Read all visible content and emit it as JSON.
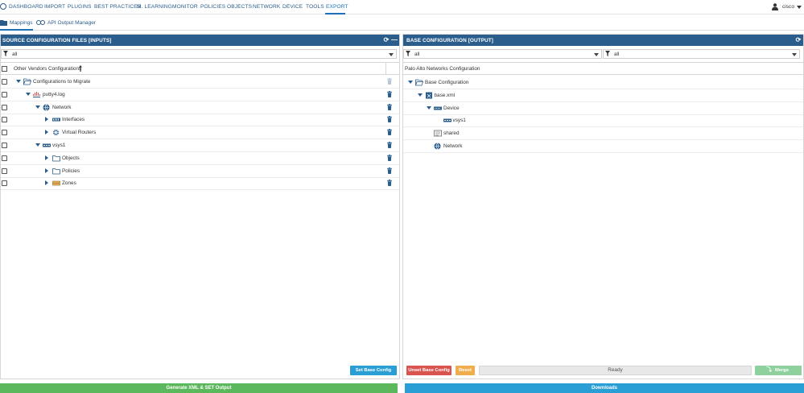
{
  "nav": {
    "items": [
      "DASHBOARD",
      "IMPORT",
      "PLUGINS",
      "BEST PRACTICES",
      "M. LEARNING",
      "MONITOR",
      "POLICIES",
      "OBJECTS",
      "NETWORK",
      "DEVICE",
      "TOOLS",
      "EXPORT"
    ],
    "active": "EXPORT",
    "user": "cisco"
  },
  "subnav": {
    "tabs": [
      "Mappings",
      "API Output Manager"
    ],
    "active": "Mappings"
  },
  "left_panel": {
    "title": "SOURCE CONFIGURATION FILES [INPUTS]",
    "filter": "all",
    "tree_header": "Other Vendors Configurations",
    "rows": [
      {
        "label": "Configurations to Migrate",
        "icon": "folder-open-icon",
        "level": 0,
        "state": "open"
      },
      {
        "label": "putty4.log",
        "icon": "cisco-logo-icon",
        "level": 1,
        "state": "open"
      },
      {
        "label": "Network",
        "icon": "globe-icon",
        "level": 2,
        "state": "open"
      },
      {
        "label": "Interfaces",
        "icon": "ethernet-port-icon",
        "level": 3,
        "state": "closed"
      },
      {
        "label": "Virtual Routers",
        "icon": "router-icon",
        "level": 3,
        "state": "closed"
      },
      {
        "label": "vsys1",
        "icon": "vsys-icon",
        "level": 2,
        "state": "open"
      },
      {
        "label": "Objects",
        "icon": "folder-icon",
        "level": 3,
        "state": "closed"
      },
      {
        "label": "Policies",
        "icon": "folder-icon",
        "level": 3,
        "state": "closed"
      },
      {
        "label": "Zones",
        "icon": "zones-icon",
        "level": 3,
        "state": "closed"
      }
    ],
    "set_base_button": "Set Base Config"
  },
  "right_panel": {
    "title": "BASE CONFIGURATION [OUTPUT]",
    "filter_left": "all",
    "filter_right": "all",
    "tree_header": "Palo Alto Networks Configuration",
    "rows": [
      {
        "label": "Base Configuration",
        "icon": "folder-open-icon",
        "level": 0,
        "state": "open"
      },
      {
        "label": "base.xml",
        "icon": "xml-file-icon",
        "level": 1,
        "state": "open"
      },
      {
        "label": "Device",
        "icon": "device-icon",
        "level": 2,
        "state": "open"
      },
      {
        "label": "vsys1",
        "icon": "vsys-icon",
        "level": 3,
        "state": "none"
      },
      {
        "label": "shared",
        "icon": "shared-icon",
        "level": 2,
        "state": "none"
      },
      {
        "label": "Network",
        "icon": "globe-icon",
        "level": 2,
        "state": "none"
      }
    ],
    "unset_button": "Unset Base Config",
    "reset_button": "Reset",
    "status": "Ready",
    "merge_button": "Merge"
  },
  "bottom": {
    "generate_button": "Generate XML & SET Output",
    "downloads_button": "Downloads"
  },
  "colors": {
    "header_blue": "#2a5d8c",
    "button_blue": "#2a9fd6",
    "button_red": "#d9534f",
    "button_orange": "#f0ad4e",
    "button_green_light": "#8fd19e",
    "generate_green": "#5cb85c",
    "downloads_blue": "#2a9fd6"
  }
}
